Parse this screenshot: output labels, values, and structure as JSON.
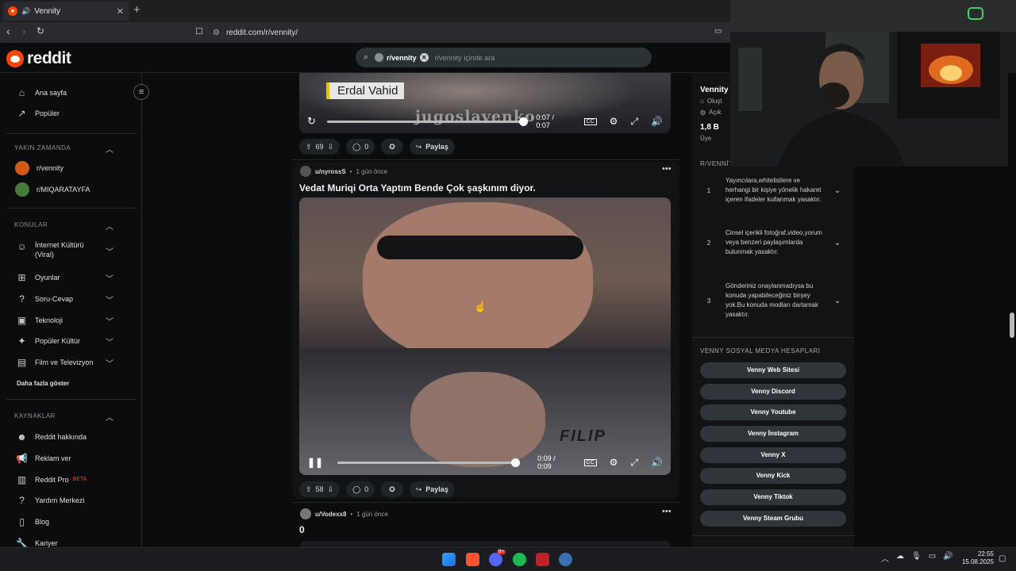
{
  "browser": {
    "tab_title": "Vennity",
    "url": "reddit.com/r/vennity/"
  },
  "header": {
    "logo_text": "reddit",
    "search_chip": "r/vennity",
    "search_placeholder": "r/vennity içinde ara"
  },
  "sidebar": {
    "top_items": [
      "Ana sayfa",
      "Popüler"
    ],
    "recent_heading": "YAKIN ZAMANDA",
    "recent": [
      "r/vennity",
      "r/MIQARATAYFA"
    ],
    "topics_heading": "KONULAR",
    "topics": [
      "İnternet Kültürü (Viral)",
      "Oyunlar",
      "Soru-Cevap",
      "Teknoloji",
      "Popüler Kültür",
      "Film ve Televizyon"
    ],
    "show_more": "Daha fazla göster",
    "resources_heading": "KAYNAKLAR",
    "resources": [
      "Reddit hakkında",
      "Reklam ver",
      "Reddit Pro",
      "Yardım Merkezi",
      "Blog",
      "Kariyer"
    ],
    "pro_badge": "BETA"
  },
  "feed": {
    "post1": {
      "overlay_name": "Erdal Vahid",
      "watermark": "jugoslavenko",
      "time": "0:07 / 0:07",
      "progress": 1.0,
      "votes": "69",
      "comments": "0",
      "share": "Paylaş"
    },
    "post2": {
      "author": "u/nyrossS",
      "age": "1 gün önce",
      "title": "Vedat Muriqi Orta Yaptım Bende Çok şaşkınım diyor.",
      "shirt_text": "FILIP",
      "time": "0:09 / 0:09",
      "progress": 1.0,
      "votes": "58",
      "comments": "0",
      "share": "Paylaş"
    },
    "post3": {
      "author": "u/Vodexx8",
      "age": "1 gün önce",
      "title": "0"
    }
  },
  "right_panel": {
    "community_name": "Vennity",
    "created_label": "Oluşt",
    "visibility_label": "Açık",
    "members_count": "1,8 B",
    "members_label": "Üye",
    "rules_heading": "R/VENNİTY",
    "rules": [
      {
        "n": "1",
        "text": "Yayıncılara,whitelistlere ve herhangi bir kişiye yönelik hakaret içeren ifadeler kullanmak yasaktır."
      },
      {
        "n": "2",
        "text": "Cinsel içerikli fotoğraf,video,yorum veya benzeri paylaşımlarda bulunmak yasaktır."
      },
      {
        "n": "3",
        "text": "Gönderiniz onaylanmadıysa bu konuda yapabileceğiniz birşey yok.Bu konuda modları darlamak yasaktır."
      }
    ],
    "social_heading": "VENNY SOSYAL MEDYA HESAPLARI",
    "social_buttons": [
      "Venny Web Sitesi",
      "Venny Discord",
      "Venny Youtube",
      "Venny İnstagram",
      "Venny X",
      "Venny Kick",
      "Venny Tiktok",
      "Venny Steam Grubu"
    ]
  },
  "taskbar": {
    "time": "22:55",
    "date": "15.08.2025",
    "discord_badge": "9+"
  },
  "colors": {
    "brand": "#ff4500",
    "background": "#0b0c0e",
    "panel": "#111315",
    "button": "#2f3538"
  }
}
